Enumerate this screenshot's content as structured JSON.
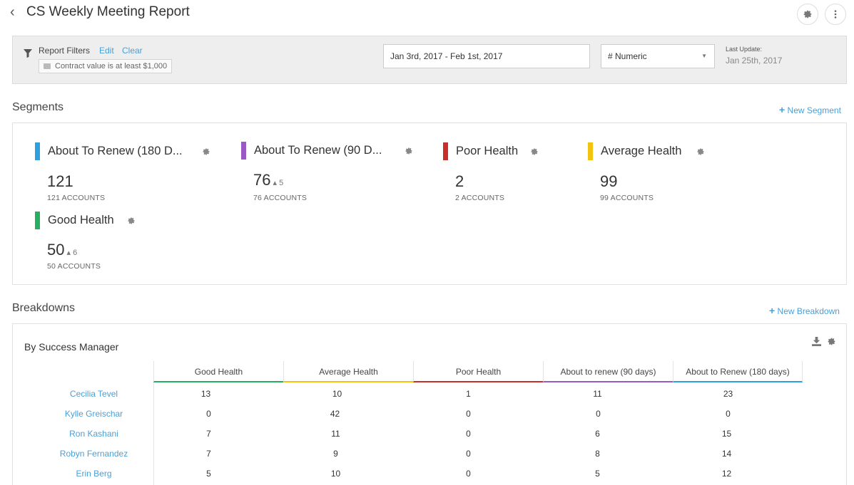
{
  "header": {
    "title": "CS Weekly Meeting Report"
  },
  "filters": {
    "label": "Report Filters",
    "edit": "Edit",
    "clear": "Clear",
    "chip": "Contract value is at least $1,000",
    "date_range": "Jan 3rd, 2017 - Feb 1st, 2017",
    "metric_select": "# Numeric",
    "last_update_label": "Last Update:",
    "last_update_value": "Jan 25th, 2017"
  },
  "segments": {
    "title": "Segments",
    "new_label": "New Segment",
    "items": [
      {
        "name": "About To Renew (180 D...",
        "count": "121",
        "delta": "",
        "sub": "121 ACCOUNTS",
        "color": "#2f9fe0"
      },
      {
        "name": "About To Renew (90 D...",
        "count": "76",
        "delta": "5",
        "sub": "76 ACCOUNTS",
        "color": "#9b59c6"
      },
      {
        "name": "Poor Health",
        "count": "2",
        "delta": "",
        "sub": "2 ACCOUNTS",
        "color": "#c9302c"
      },
      {
        "name": "Average Health",
        "count": "99",
        "delta": "",
        "sub": "99 ACCOUNTS",
        "color": "#f2c40f"
      },
      {
        "name": "Good Health",
        "count": "50",
        "delta": "6",
        "sub": "50 ACCOUNTS",
        "color": "#27ae60"
      }
    ]
  },
  "breakdowns": {
    "title": "Breakdowns",
    "new_label": "New Breakdown",
    "table_title": "By Success Manager",
    "columns": [
      {
        "label": "Good Health",
        "color": "#27ae60"
      },
      {
        "label": "Average Health",
        "color": "#f2c40f"
      },
      {
        "label": "Poor Health",
        "color": "#c9302c"
      },
      {
        "label": "About to renew (90 days)",
        "color": "#9b59c6"
      },
      {
        "label": "About to Renew (180 days)",
        "color": "#2f9fe0"
      }
    ],
    "rows": [
      {
        "name": "Cecilia Tevel",
        "values": [
          "13",
          "10",
          "1",
          "11",
          "23"
        ]
      },
      {
        "name": "Kylle Greischar",
        "values": [
          "0",
          "42",
          "0",
          "0",
          "0"
        ]
      },
      {
        "name": "Ron Kashani",
        "values": [
          "7",
          "11",
          "0",
          "6",
          "15"
        ]
      },
      {
        "name": "Robyn Fernandez",
        "values": [
          "7",
          "9",
          "0",
          "8",
          "14"
        ]
      },
      {
        "name": "Erin Berg",
        "values": [
          "5",
          "10",
          "0",
          "5",
          "12"
        ]
      }
    ]
  }
}
